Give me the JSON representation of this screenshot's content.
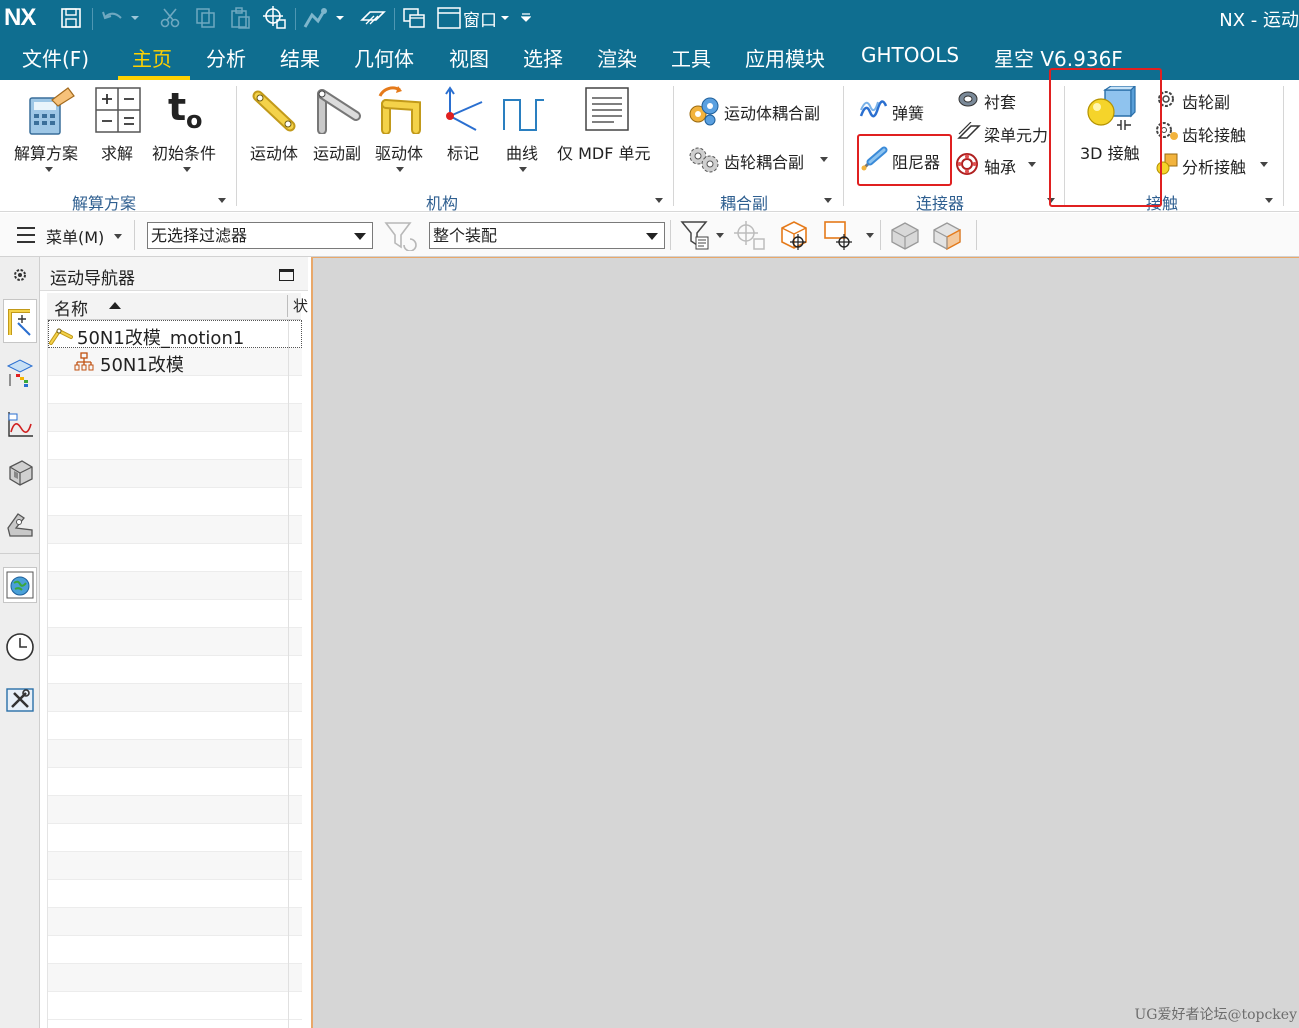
{
  "titlebar": {
    "logo": "NX",
    "window_menu_label": "窗口",
    "title": "NX - 运动"
  },
  "menubar": {
    "tabs": [
      "文件(F)",
      "主页",
      "分析",
      "结果",
      "几何体",
      "视图",
      "选择",
      "渲染",
      "工具",
      "应用模块",
      "GHTOOLS",
      "星空 V6.936F"
    ],
    "active_tab": "主页"
  },
  "ribbon": {
    "groups": {
      "solution": {
        "label": "解算方案",
        "items": [
          "解算方案",
          "求解",
          "初始条件"
        ]
      },
      "mechanism": {
        "label": "机构",
        "items": [
          "运动体",
          "运动副",
          "驱动体",
          "标记",
          "曲线",
          "仅 MDF 单元"
        ]
      },
      "coupler": {
        "label": "耦合副",
        "items": [
          "运动体耦合副",
          "齿轮耦合副"
        ]
      },
      "connector": {
        "label": "连接器",
        "items": [
          "弹簧",
          "衬套",
          "梁单元力",
          "阻尼器",
          "轴承"
        ]
      },
      "contact": {
        "label": "接触",
        "items": [
          "3D 接触",
          "齿轮副",
          "齿轮接触",
          "分析接触"
        ]
      }
    },
    "highlight_color": "#e02020"
  },
  "toolbar": {
    "menu_label": "菜单(M)",
    "filter_value": "无选择过滤器",
    "scope_value": "整个装配"
  },
  "navigator": {
    "title": "运动导航器",
    "columns": [
      "名称",
      "状"
    ],
    "rows": [
      {
        "label": "50N1改模_motion1",
        "icon": "motion-sim-icon"
      },
      {
        "label": "50N1改模",
        "icon": "assembly-icon"
      }
    ]
  },
  "resource_bar": {
    "icons": [
      "settings-icon",
      "motion-navigator-icon",
      "model-view-icon",
      "plot-icon",
      "part-icon",
      "sheet-metal-icon",
      "web-browser-icon",
      "history-icon",
      "tools-icon"
    ]
  },
  "watermark": "UG爱好者论坛@topckey",
  "colors": {
    "titlebar_bg": "#0f6e90",
    "active_tab": "#ffd100",
    "graphics_bg": "#d6d6d6",
    "group_label": "#2f5f90"
  }
}
